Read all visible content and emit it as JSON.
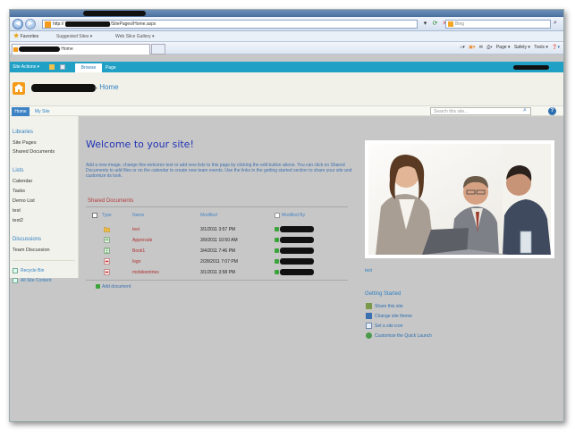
{
  "browser": {
    "address": {
      "url_prefix": "http://",
      "url_suffix": "/SitePages/Home.aspx"
    },
    "search": {
      "placeholder": "Bing"
    },
    "favorites": {
      "label": "Favorites",
      "suggested": "Suggested Sites ▾",
      "gallery": "Web Slice Gallery ▾"
    },
    "tab": {
      "label": "Home"
    },
    "commands": [
      "Page ▾",
      "Safety ▾",
      "Tools ▾"
    ]
  },
  "ribbon": {
    "site_actions": "Site Actions ▾",
    "tabs": [
      {
        "label": "Browse"
      },
      {
        "label": "Page"
      }
    ]
  },
  "site": {
    "breadcrumb_arrow": "▸",
    "breadcrumb_current": "Home"
  },
  "topnav": {
    "items": [
      {
        "label": "Home"
      },
      {
        "label": "My Site"
      }
    ],
    "search_placeholder": "Search this site..."
  },
  "quicklaunch": {
    "libraries": {
      "heading": "Libraries",
      "items": [
        "Site Pages",
        "Shared Documents"
      ]
    },
    "lists": {
      "heading": "Lists",
      "items": [
        "Calendar",
        "Tasks",
        "Demo List",
        "test",
        "test2"
      ]
    },
    "discussions": {
      "heading": "Discussions",
      "items": [
        "Team Discussion"
      ]
    },
    "utilities": [
      "Recycle Bin",
      "All Site Content"
    ]
  },
  "main": {
    "title": "Welcome to your site!",
    "intro": "Add a new image, change this welcome text or add new lists to this page by clicking the edit button above. You can click on Shared Documents to add files or on the calendar to create new team events. Use the links in the getting started section to share your site and customize its look.",
    "doclib": {
      "title": "Shared Documents",
      "columns": [
        "Type",
        "Name",
        "Modified",
        "Modified By"
      ],
      "rows": [
        {
          "type": "folder",
          "name": "test",
          "modified": "3/1/2011 3:57 PM"
        },
        {
          "type": "doc",
          "name": "Approvals",
          "modified": "3/9/2011 10:50 AM"
        },
        {
          "type": "doc",
          "name": "Book1",
          "modified": "3/4/2011 7:46 PM"
        },
        {
          "type": "pdf",
          "name": "logo",
          "modified": "2/28/2011 7:07 PM"
        },
        {
          "type": "pdf",
          "name": "mobileentries",
          "modified": "3/1/2011 3:58 PM"
        }
      ],
      "add_label": "Add document"
    },
    "photo_caption": "test",
    "getting_started": {
      "title": "Getting Started",
      "items": [
        "Share this site",
        "Change site theme",
        "Set a site icon",
        "Customize the Quick Launch"
      ]
    }
  }
}
